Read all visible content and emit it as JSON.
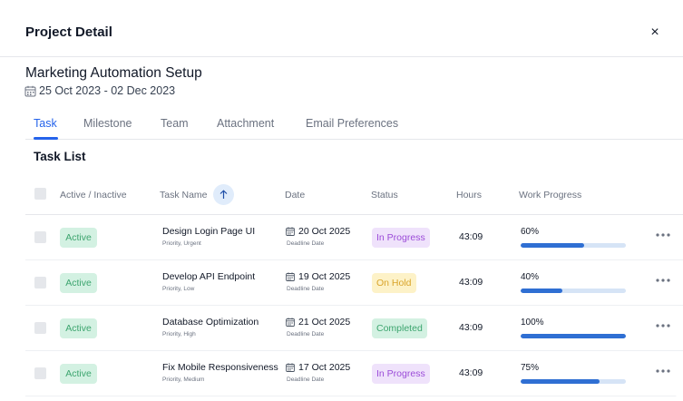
{
  "modal": {
    "title": "Project Detail",
    "close_label": "×"
  },
  "project": {
    "name": "Marketing Automation Setup",
    "dates": "25 Oct 2023 - 02 Dec 2023"
  },
  "tabs": [
    {
      "label": "Task",
      "active": true
    },
    {
      "label": "Milestone",
      "active": false
    },
    {
      "label": "Team",
      "active": false
    },
    {
      "label": "Attachment",
      "active": false
    },
    {
      "label": "Email Preferences",
      "active": false
    }
  ],
  "task_list": {
    "title": "Task List",
    "columns": {
      "active": "Active / Inactive",
      "task": "Task Name",
      "date": "Date",
      "status": "Status",
      "hours": "Hours",
      "progress": "Work Progress"
    },
    "rows": [
      {
        "active_label": "Active",
        "task_name": "Design Login Page UI",
        "priority": "Priority, Urgent",
        "date": "20 Oct 2025",
        "date_sub": "Deadline Date",
        "status": "In Progress",
        "status_type": "in-progress",
        "hours": "43:09",
        "progress_label": "60%",
        "progress": 60
      },
      {
        "active_label": "Active",
        "task_name": "Develop API Endpoint",
        "priority": "Priority, Low",
        "date": "19 Oct 2025",
        "date_sub": "Deadline Date",
        "status": "On Hold",
        "status_type": "on-hold",
        "hours": "43:09",
        "progress_label": "40%",
        "progress": 40
      },
      {
        "active_label": "Active",
        "task_name": "Database Optimization",
        "priority": "Priority, High",
        "date": "21 Oct 2025",
        "date_sub": "Deadline Date",
        "status": "Completed",
        "status_type": "completed",
        "hours": "43:09",
        "progress_label": "100%",
        "progress": 100
      },
      {
        "active_label": "Active",
        "task_name": "Fix Mobile Responsiveness",
        "priority": "Priority, Medium",
        "date": "17 Oct 2025",
        "date_sub": "Deadline Date",
        "status": "In Progress",
        "status_type": "in-progress",
        "hours": "43:09",
        "progress_label": "75%",
        "progress": 75
      }
    ]
  },
  "colors": {
    "accent": "#2563eb",
    "progress_fill": "#2f6fd3",
    "active_badge_bg": "#d3f1e2",
    "active_badge_text": "#3da56f",
    "in_progress_bg": "#efe2fb",
    "in_progress_text": "#9b4bd8",
    "on_hold_bg": "#fdf2c8",
    "on_hold_text": "#d9a42a",
    "completed_bg": "#d3f1e2",
    "completed_text": "#3da56f"
  },
  "icons": {
    "calendar": "calendar-icon",
    "close": "close-icon",
    "sort": "arrow-up-icon",
    "more": "more-horizontal-icon"
  }
}
